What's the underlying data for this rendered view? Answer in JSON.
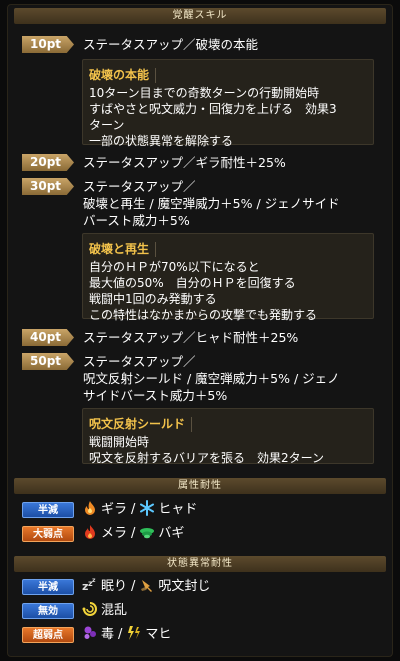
{
  "headers": {
    "awakening_skill": "覚醒スキル",
    "attribute_resist": "属性耐性",
    "status_resist": "状態異常耐性"
  },
  "skills": [
    {
      "pt": "10pt",
      "text": "ステータスアップ／破壊の本能",
      "detail": {
        "title": "破壊の本能",
        "body": "10ターン目までの奇数ターンの行動開始時\nすばやさと呪文威力・回復力を上げる　効果3\nターン\n一部の状態異常を解除する"
      }
    },
    {
      "pt": "20pt",
      "text": "ステータスアップ／ギラ耐性＋25%"
    },
    {
      "pt": "30pt",
      "text": "ステータスアップ／\n破壊と再生 / 魔空弾威力＋5% / ジェノサイド\nバースト威力＋5%",
      "detail": {
        "title": "破壊と再生",
        "body": "自分のＨＰが70%以下になると\n最大値の50%　自分のＨＰを回復する\n戦闘中1回のみ発動する\nこの特性はなかまからの攻撃でも発動する"
      }
    },
    {
      "pt": "40pt",
      "text": "ステータスアップ／ヒャド耐性＋25%"
    },
    {
      "pt": "50pt",
      "text": "ステータスアップ／\n呪文反射シールド / 魔空弾威力＋5% / ジェノ\nサイドバースト威力＋5%",
      "detail": {
        "title": "呪文反射シールド",
        "body": "戦闘開始時\n呪文を反射するバリアを張る　効果2ターン"
      }
    }
  ],
  "attribute_resist": [
    {
      "badge": "半減",
      "badge_color": "blue",
      "items": [
        {
          "icon": "fire-icon",
          "label": "ギラ"
        },
        {
          "icon": "ice-icon",
          "label": "ヒャド"
        }
      ]
    },
    {
      "badge": "大弱点",
      "badge_color": "orange",
      "items": [
        {
          "icon": "flame-icon",
          "label": "メラ"
        },
        {
          "icon": "wind-icon",
          "label": "バギ"
        }
      ]
    }
  ],
  "status_resist": [
    {
      "badge": "半減",
      "badge_color": "blue",
      "items": [
        {
          "icon": "sleep-icon",
          "label": "眠り"
        },
        {
          "icon": "spell-seal-icon",
          "label": "呪文封じ"
        }
      ]
    },
    {
      "badge": "無効",
      "badge_color": "blue",
      "items": [
        {
          "icon": "confusion-icon",
          "label": "混乱"
        }
      ]
    },
    {
      "badge": "超弱点",
      "badge_color": "orange",
      "items": [
        {
          "icon": "poison-icon",
          "label": "毒"
        },
        {
          "icon": "paralysis-icon",
          "label": "マヒ"
        }
      ]
    }
  ],
  "colors": {
    "accent_gold": "#f2c24b",
    "badge_blue": "#1c4fa6",
    "badge_orange": "#b24a10"
  }
}
